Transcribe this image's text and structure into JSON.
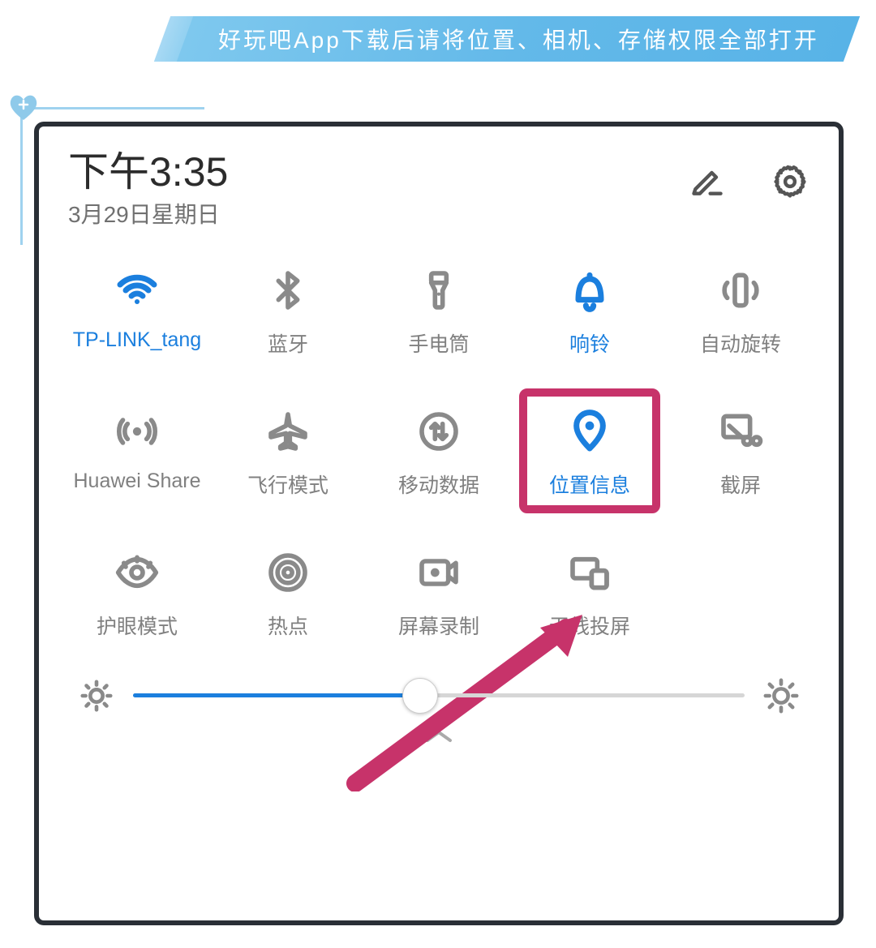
{
  "banner_text": "好玩吧App下载后请将位置、相机、存储权限全部打开",
  "time": "下午3:35",
  "date": "3月29日星期日",
  "tiles": [
    {
      "label": "TP-LINK_tang",
      "icon": "wifi-icon",
      "active": true
    },
    {
      "label": "蓝牙",
      "icon": "bluetooth-icon",
      "active": false
    },
    {
      "label": "手电筒",
      "icon": "flashlight-icon",
      "active": false
    },
    {
      "label": "响铃",
      "icon": "bell-icon",
      "active": true
    },
    {
      "label": "自动旋转",
      "icon": "auto-rotate-icon",
      "active": false
    },
    {
      "label": "Huawei Share",
      "icon": "huawei-share-icon",
      "active": false
    },
    {
      "label": "飞行模式",
      "icon": "airplane-icon",
      "active": false
    },
    {
      "label": "移动数据",
      "icon": "mobile-data-icon",
      "active": false
    },
    {
      "label": "位置信息",
      "icon": "location-icon",
      "active": true,
      "highlighted": true
    },
    {
      "label": "截屏",
      "icon": "screenshot-icon",
      "active": false
    },
    {
      "label": "护眼模式",
      "icon": "eye-comfort-icon",
      "active": false
    },
    {
      "label": "热点",
      "icon": "hotspot-icon",
      "active": false
    },
    {
      "label": "屏幕录制",
      "icon": "screen-record-icon",
      "active": false
    },
    {
      "label": "无线投屏",
      "icon": "wireless-projection-icon",
      "active": false
    }
  ],
  "brightness": {
    "percent": 47
  },
  "colors": {
    "accent": "#1b7fde",
    "highlight": "#c7336a",
    "banner": "#63b9e9"
  }
}
